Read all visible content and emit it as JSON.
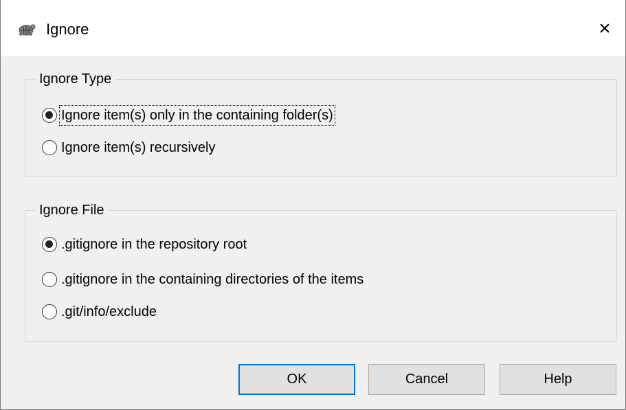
{
  "window": {
    "title": "Ignore",
    "close_glyph": "×",
    "icon": "tortoisegit-icon"
  },
  "ignore_type": {
    "legend": "Ignore Type",
    "options": [
      {
        "label": "Ignore item(s) only in the containing folder(s)",
        "checked": true
      },
      {
        "label": "Ignore item(s) recursively",
        "checked": false
      }
    ]
  },
  "ignore_file": {
    "legend": "Ignore File",
    "options": [
      {
        "label": ".gitignore in the repository root",
        "checked": true
      },
      {
        "label": ".gitignore in the containing directories of the items",
        "checked": false
      },
      {
        "label": ".git/info/exclude",
        "checked": false
      }
    ]
  },
  "buttons": {
    "ok": "OK",
    "cancel": "Cancel",
    "help": "Help"
  },
  "colors": {
    "dialog_bg": "#f0f0f0",
    "accent": "#0078d7"
  }
}
